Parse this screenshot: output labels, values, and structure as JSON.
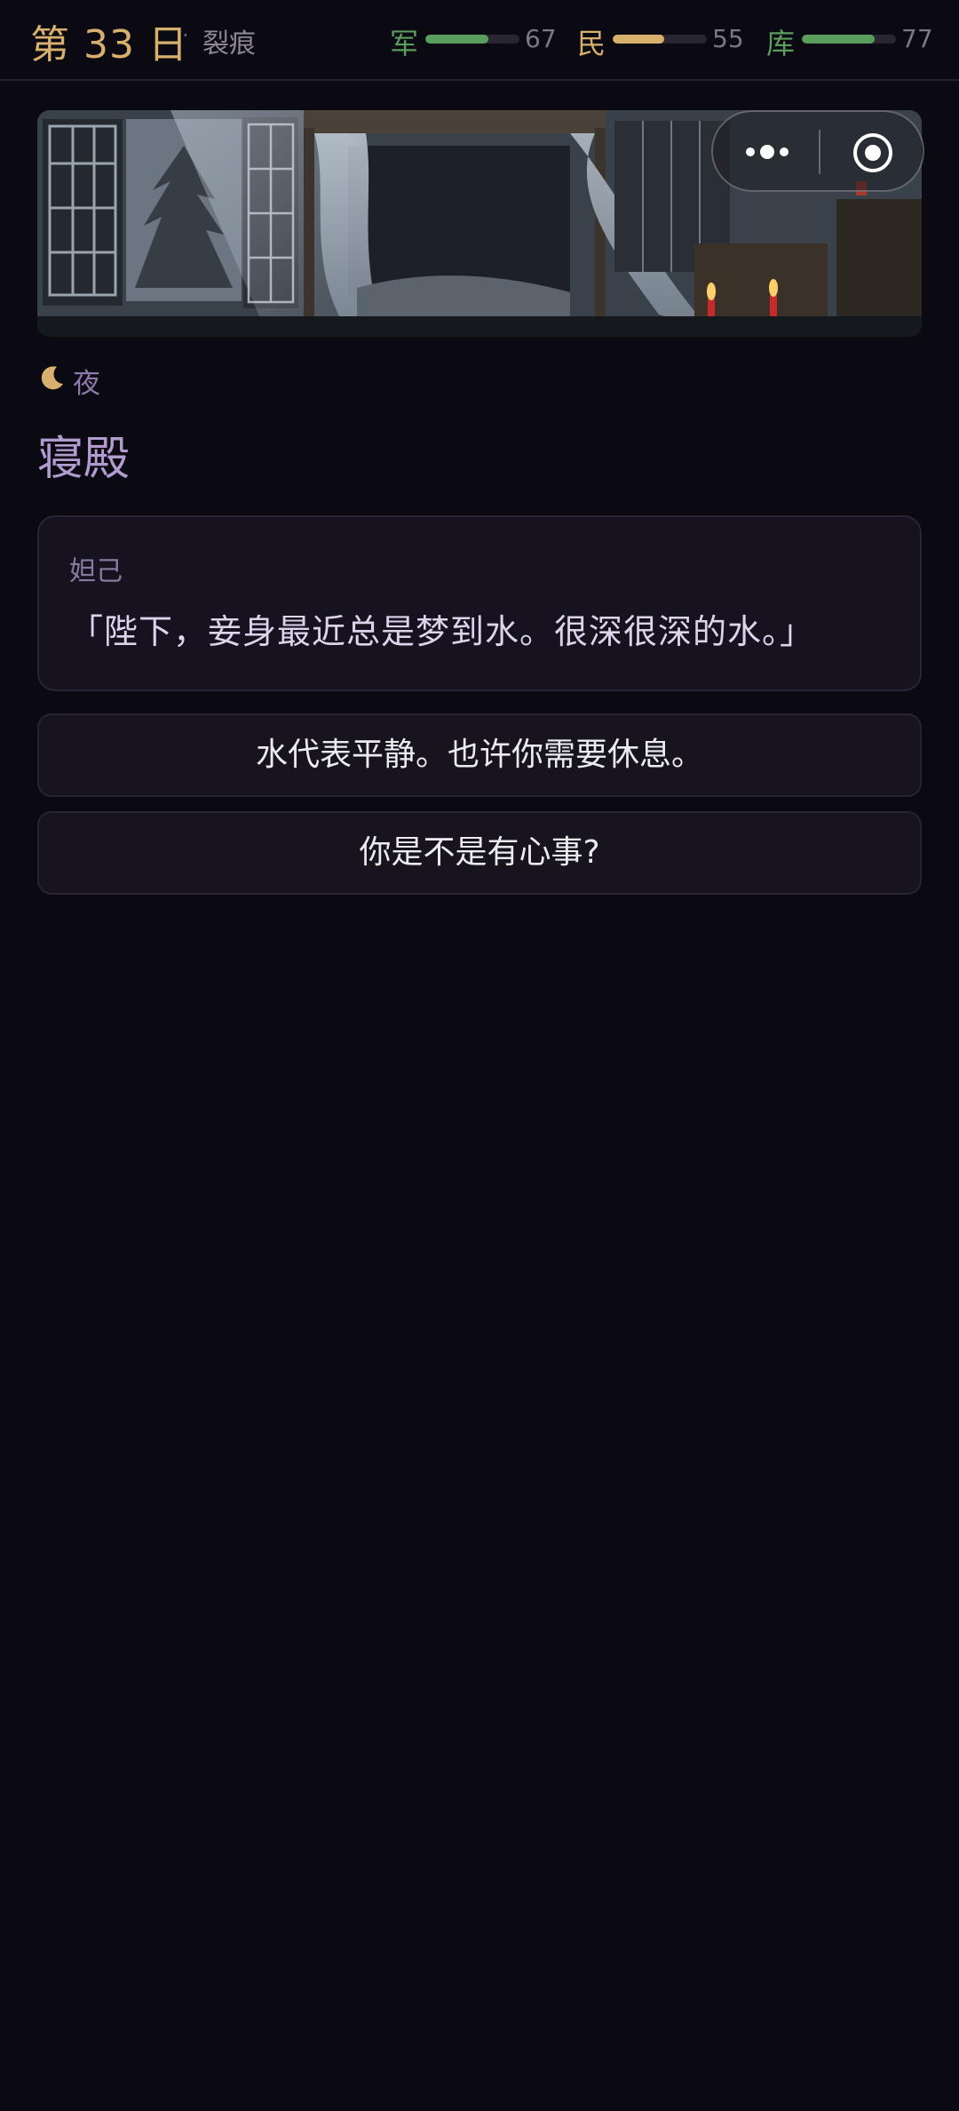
{
  "header": {
    "day": "第 33 日",
    "separator": "·",
    "chapter": "裂痕",
    "stats": [
      {
        "label": "军",
        "value": 67,
        "value_text": "67",
        "label_color": "#5a9e5e",
        "bar_color": "#5a9e5e"
      },
      {
        "label": "民",
        "value": 55,
        "value_text": "55",
        "label_color": "#d8b06e",
        "bar_color": "#d8b06e"
      },
      {
        "label": "库",
        "value": 77,
        "value_text": "77",
        "label_color": "#5a9e5e",
        "bar_color": "#5a9e5e"
      }
    ]
  },
  "capsule": {
    "more_icon": "more-dots-icon",
    "close_icon": "target-icon"
  },
  "scene": {
    "time_icon": "moon-icon",
    "time": "夜",
    "location": "寝殿"
  },
  "dialogue": {
    "speaker": "妲己",
    "text": "「陛下，妾身最近总是梦到水。很深很深的水。」"
  },
  "choices": [
    {
      "label": "水代表平静。也许你需要休息。"
    },
    {
      "label": "你是不是有心事?"
    }
  ]
}
